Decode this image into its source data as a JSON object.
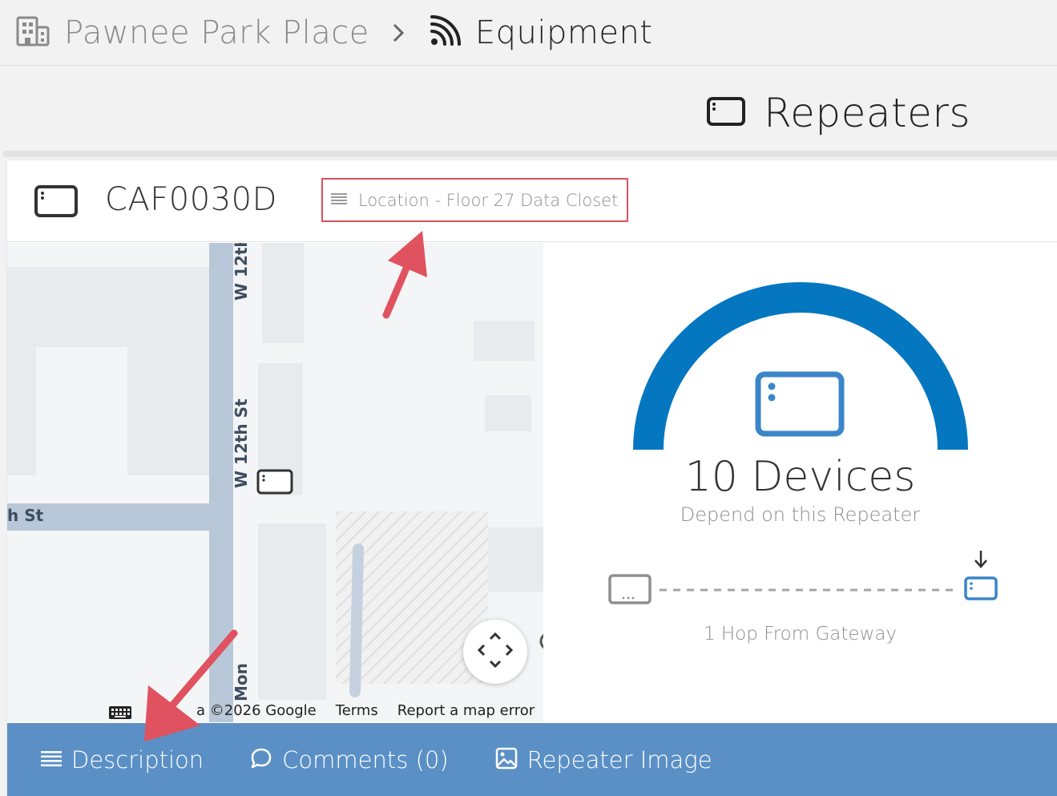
{
  "breadcrumb": {
    "building_name": "Pawnee Park Place",
    "current_page": "Equipment",
    "building_icon": "building-icon",
    "separator_icon": "chevron-right-icon",
    "equipment_icon": "wifi-signal-icon"
  },
  "section": {
    "title": "Repeaters",
    "icon": "repeater-icon"
  },
  "device": {
    "id": "CAF0030D",
    "location": "Location - Floor 27 Data Closet",
    "location_icon": "lines-icon"
  },
  "map": {
    "street_vertical": "W 12th St",
    "street_horizontal": "h St",
    "street_partial": "Mon",
    "attribution": "a ©2026 Google",
    "terms": "Terms",
    "report": "Report a map error"
  },
  "stats": {
    "devices_count": "10 Devices",
    "devices_sub": "Depend on this Repeater",
    "hops": "1 Hop From Gateway"
  },
  "tabs": [
    {
      "label": "Description",
      "icon": "lines-icon"
    },
    {
      "label": "Comments (0)",
      "icon": "comment-icon"
    },
    {
      "label": "Repeater Image",
      "icon": "image-icon"
    }
  ],
  "colors": {
    "accent_blue": "#0577c1",
    "tabbar": "#5b90c6",
    "highlight_red": "#d9515e",
    "annotation_arrow": "#e0525f"
  }
}
